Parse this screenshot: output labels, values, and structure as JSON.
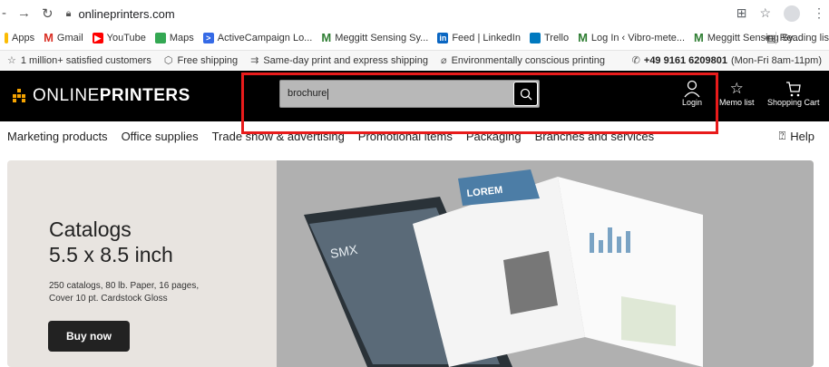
{
  "browser": {
    "url": "onlineprinters.com",
    "bookmarks": [
      {
        "label": "Apps",
        "icon": "apps-icon",
        "color": "#4285f4"
      },
      {
        "label": "Gmail",
        "icon": "gmail-icon",
        "color": "#d93025"
      },
      {
        "label": "YouTube",
        "icon": "youtube-icon",
        "color": "#ff0000"
      },
      {
        "label": "Maps",
        "icon": "maps-icon",
        "color": "#34a853"
      },
      {
        "label": "ActiveCampaign Lo...",
        "icon": "activecampaign-icon",
        "color": "#356ae6"
      },
      {
        "label": "Meggitt Sensing Sy...",
        "icon": "meggitt-icon",
        "color": "#2e7d32"
      },
      {
        "label": "Feed | LinkedIn",
        "icon": "linkedin-icon",
        "color": "#0a66c2"
      },
      {
        "label": "Trello",
        "icon": "trello-icon",
        "color": "#0079bf"
      },
      {
        "label": "Log In ‹ Vibro-mete...",
        "icon": "meggitt-icon",
        "color": "#2e7d32"
      },
      {
        "label": "Meggitt Sensing Sy...",
        "icon": "meggitt-icon",
        "color": "#2e7d32"
      }
    ],
    "more_label": "»",
    "reading_list": "Reading lis"
  },
  "usp": {
    "items": [
      {
        "label": "1 million+ satisfied customers",
        "icon": "star-icon"
      },
      {
        "label": "Free shipping",
        "icon": "box-icon"
      },
      {
        "label": "Same-day print and express shipping",
        "icon": "truck-icon"
      },
      {
        "label": "Environmentally conscious printing",
        "icon": "leaf-icon"
      }
    ],
    "phone_number": "+49 9161 6209801",
    "phone_hours": "(Mon-Fri 8am-11pm)"
  },
  "header": {
    "logo_light": "ONLINE",
    "logo_bold": "PRINTERS",
    "search_value": "brochure",
    "login_label": "Login",
    "memo_label": "Memo list",
    "cart_label": "Shopping Cart"
  },
  "menu": {
    "items": [
      "Marketing products",
      "Office supplies",
      "Trade show & advertising",
      "Promotional items",
      "Packaging",
      "Branches and services"
    ],
    "help": "Help"
  },
  "hero": {
    "title_line1": "Catalogs",
    "title_line2": "5.5 x 8.5 inch",
    "desc_line1": "250 catalogs, 80 lb. Paper, 16 pages,",
    "desc_line2": "Cover 10 pt. Cardstock Gloss",
    "buy_label": "Buy now",
    "booklet_cover_text": "SMX",
    "booklet_page_text": "LOREM"
  },
  "colors": {
    "accent": "#f5a300",
    "highlight": "#e81b1b",
    "header_bg": "#000000"
  }
}
